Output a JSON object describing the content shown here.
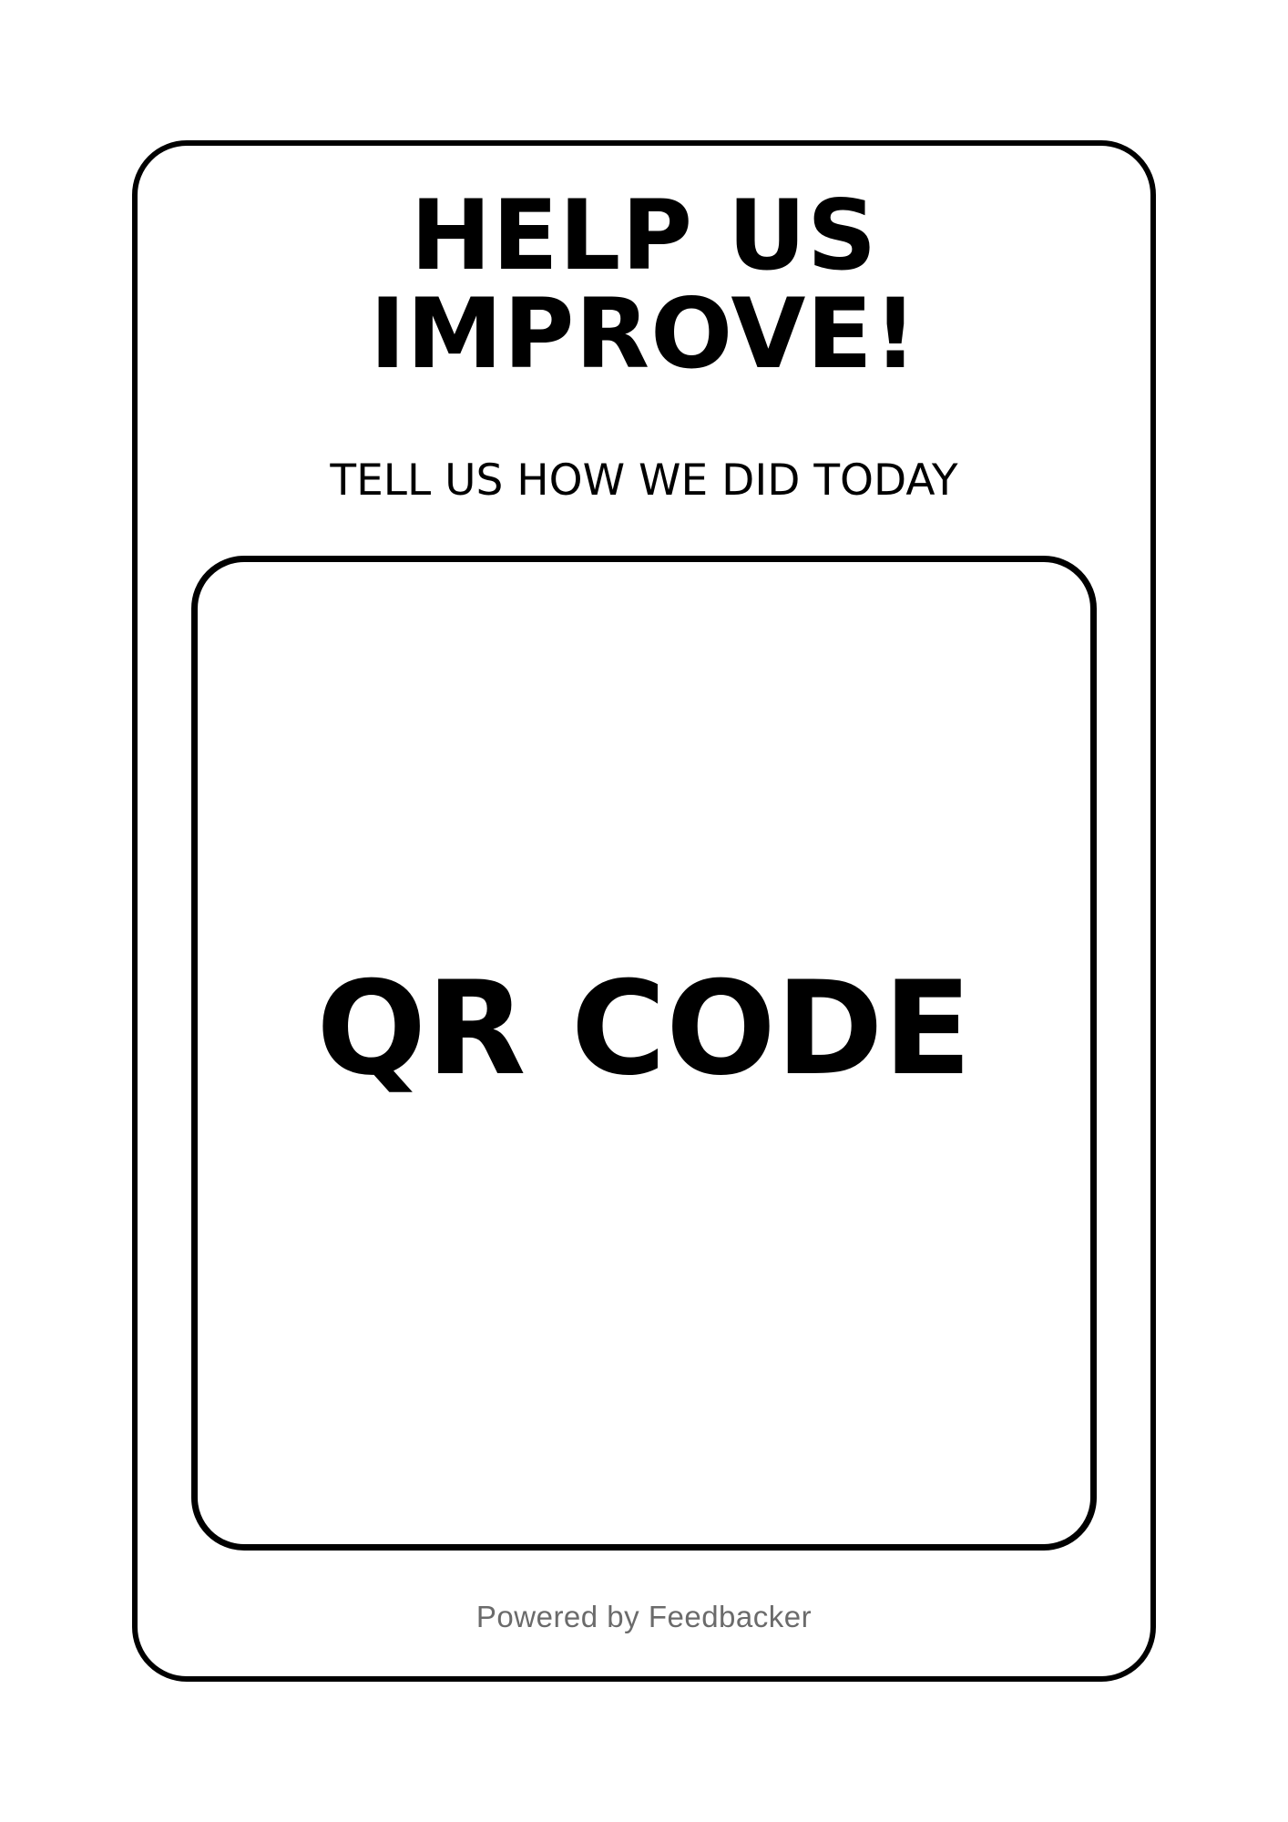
{
  "headline": {
    "line1": "HELP US",
    "line2": "IMPROVE!"
  },
  "subtitle": "TELL US HOW WE DID TODAY",
  "qr_placeholder": "QR CODE",
  "footer": {
    "powered_by": "Powered by Feedbacker"
  },
  "colors": {
    "border": "#000000",
    "text": "#000000",
    "footer_text": "#6b6b6b",
    "background": "#ffffff"
  }
}
